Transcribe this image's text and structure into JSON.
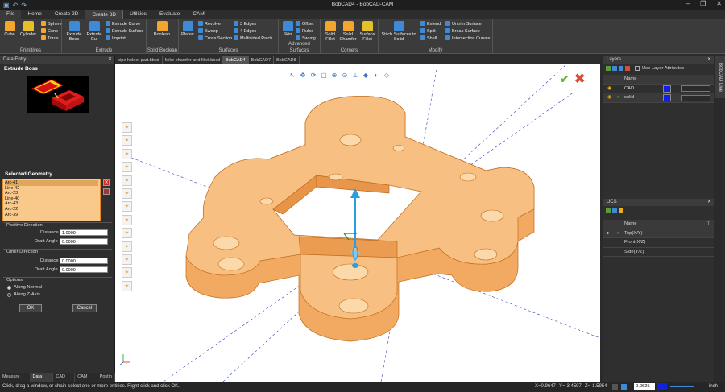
{
  "app": {
    "title": "BobCAD4 - BobCAD-CAM",
    "window_controls": [
      "minimize-icon",
      "restore-icon",
      "close-icon"
    ]
  },
  "menu": {
    "items": [
      "File",
      "Home",
      "Create 2D",
      "Create 3D",
      "Utilities",
      "Evaluate",
      "CAM"
    ],
    "active": "Create 3D"
  },
  "ribbon": {
    "groups": {
      "primitives": {
        "label": "Primitives",
        "large": [
          "Cube",
          "Cylinder"
        ],
        "small": [
          "Sphere",
          "Cone",
          "Torus"
        ]
      },
      "extrude": {
        "label": "Extrude",
        "large": [
          "Extrude Boss",
          "Extrude Cut"
        ],
        "small": [
          "Extrude Curve",
          "Extrude Surface",
          "Imprint"
        ]
      },
      "solid_boolean": {
        "label": "Solid Boolean",
        "large": [
          "Boolean"
        ]
      },
      "surfaces": {
        "label": "Surfaces",
        "large": [
          "Planar"
        ],
        "small": [
          "Revolve",
          "Sweep",
          "Cross Section",
          "3 Edges",
          "4 Edges",
          "Multisided Patch"
        ]
      },
      "advanced_surfaces": {
        "label": "Advanced Surfaces",
        "large": [
          "Skin"
        ],
        "small": [
          "Offset",
          "Ruled",
          "Swung"
        ]
      },
      "corners": {
        "label": "Corners",
        "large": [
          "Solid Fillet",
          "Solid Chamfer",
          "Surface Fillet"
        ]
      },
      "modify": {
        "label": "Modify",
        "large": [
          "Stitch Surfaces to Solid"
        ],
        "small": [
          "Extend",
          "Split",
          "Shell",
          "Untrim Surface",
          "Break Surface",
          "Intersection Curves"
        ]
      }
    }
  },
  "data_entry": {
    "panel_title": "Data Entry",
    "heading": "Extrude Boss",
    "selected_geometry_label": "Selected Geometry",
    "geometry_items": [
      "Arc-41",
      "Line-42",
      "Arc-23",
      "Line-40",
      "Arc-43",
      "Arc-22",
      "Arc-39"
    ],
    "positive_direction": {
      "label": "Positive Direction",
      "distance_label": "Distance",
      "distance": "1.0000",
      "draft_label": "Draft Angle",
      "draft": "0.0000"
    },
    "other_direction": {
      "label": "Other Direction",
      "distance_label": "Distance",
      "distance": "0.0000",
      "draft_label": "Draft Angle",
      "draft": "0.0000"
    },
    "options": {
      "label": "Options",
      "along_normal": "Along Normal",
      "along_z": "Along Z-Axis",
      "selected": "Along Normal"
    },
    "ok": "OK",
    "cancel": "Cancel",
    "bottom_tabs": [
      "Measure Enti",
      "Data Entr",
      "CAD Tre",
      "CAM Tre",
      "Postin"
    ],
    "active_bottom_tab": "Data Entr"
  },
  "doc_tabs": [
    "pipe holder part.bbcd",
    "Mike chamfer and fillet.bbcd",
    "BobCAD4",
    "BobCAD7",
    "BobCAD8"
  ],
  "active_doc_tab": "BobCAD4",
  "colors": {
    "part_fill": "#f0a45a",
    "part_edge": "#c06a18",
    "accent_blue": "#1022dd",
    "ok_green": "#6ab43a",
    "cancel_red": "#d84a3a"
  },
  "layers": {
    "panel_title": "Layers",
    "use_layer_attributes": "Use Layer Attributes",
    "name_header": "Name",
    "rows": [
      "CAD",
      "solid"
    ]
  },
  "ucs": {
    "panel_title": "UCS",
    "name_header": "Name",
    "rows": [
      "Top(X/Y)",
      "Front(X/Z)",
      "Side(Y/Z)"
    ],
    "active": "Top(X/Y)"
  },
  "side_tab": "BobCAD Live",
  "status": {
    "message": "Click, drag a window, or chain-select one or more entities. Right-click and click OK.",
    "x": "X=0.9647",
    "y": "Y=-3.4597",
    "z": "Z=-1.5954",
    "step": "0.0625",
    "units": "inch"
  }
}
